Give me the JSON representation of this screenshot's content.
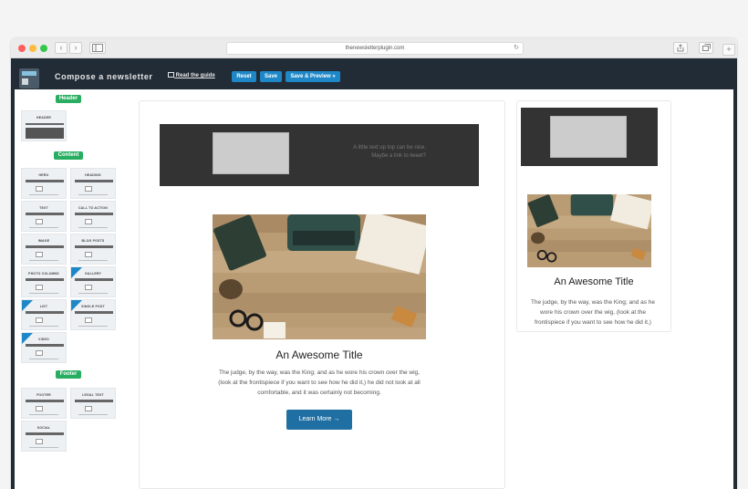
{
  "browser": {
    "url": "thenewsletterplugin.com",
    "back": "‹",
    "forward": "›",
    "reload": "↻",
    "colors": {
      "close": "#fc605c",
      "minimize": "#fdbc40",
      "maximize": "#34c84a"
    }
  },
  "app": {
    "title": "Compose a newsletter",
    "guide_link": "Read the guide",
    "reset_label": "Reset",
    "save_label": "Save",
    "save_preview_label": "Save & Preview »"
  },
  "sidebar": {
    "header_section": "Header",
    "content_section": "Content",
    "footer_section": "Footer",
    "header_blocks": [
      {
        "label": "HEADER"
      }
    ],
    "content_blocks": [
      {
        "label": "HERO",
        "pro": false
      },
      {
        "label": "HEADING",
        "pro": false
      },
      {
        "label": "TEXT",
        "pro": false
      },
      {
        "label": "CALL TO ACTION",
        "pro": false
      },
      {
        "label": "IMAGE",
        "pro": false
      },
      {
        "label": "BLOG POSTS",
        "pro": false
      },
      {
        "label": "PHOTO COLUMNS",
        "pro": false
      },
      {
        "label": "GALLERY",
        "pro": true
      },
      {
        "label": "LIST",
        "pro": true
      },
      {
        "label": "SINGLE POST",
        "pro": true
      },
      {
        "label": "VIDEO",
        "pro": true
      }
    ],
    "footer_blocks": [
      {
        "label": "FOOTER"
      },
      {
        "label": "LEGAL TEXT"
      },
      {
        "label": "SOCIAL"
      }
    ]
  },
  "newsletter": {
    "tagline_1": "A little text up top can be nice.",
    "tagline_2": "Maybe a link to tweet?",
    "title": "An Awesome Title",
    "body": "The judge, by the way, was the King; and as he wore his crown over the wig, (look at the frontispiece if you want to see how he did it,) he did not look at all comfortable, and it was certainly not becoming.",
    "button_label": "Learn More →"
  },
  "preview": {
    "title": "An Awesome Title",
    "body": "The judge, by the way, was the King; and as he wore his crown over the wig, (look at the frontispiece if you want to see how he did it,)"
  },
  "colors": {
    "accent": "#1e87c7",
    "header_bg": "#222c37",
    "section_badge": "#27ae60",
    "cta": "#1f6fa3"
  }
}
